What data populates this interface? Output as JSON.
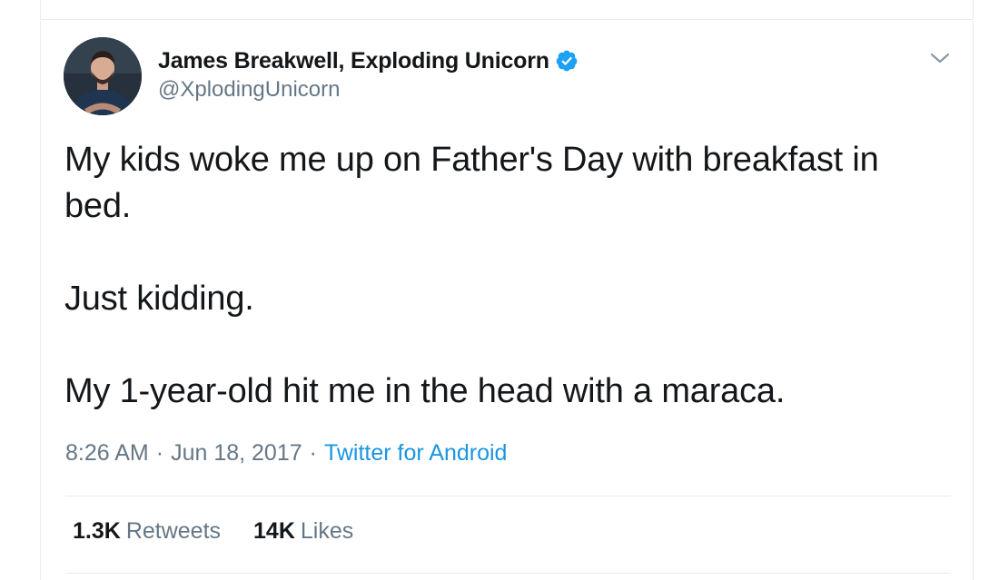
{
  "tweet": {
    "author": {
      "display_name": "James Breakwell, Exploding Unicorn",
      "handle": "@XplodingUnicorn",
      "verified": true
    },
    "text_lines": [
      "My kids woke me up on Father's Day with breakfast in",
      "bed.",
      "Just kidding.",
      "My 1-year-old hit me in the head with a maraca."
    ],
    "time": "8:26 AM",
    "date": "Jun 18, 2017",
    "source": "Twitter for Android",
    "meta_separator": "·",
    "stats": {
      "retweets_count": "1.3K",
      "retweets_label": "Retweets",
      "likes_count": "14K",
      "likes_label": "Likes"
    }
  },
  "icons": {
    "verified": "verified-badge-icon",
    "caret": "chevron-down-icon"
  },
  "colors": {
    "text_primary": "#14171a",
    "text_secondary": "#657786",
    "link_blue": "#1b95e0",
    "verified_blue": "#1da1f2",
    "border": "#e6ecf0"
  }
}
